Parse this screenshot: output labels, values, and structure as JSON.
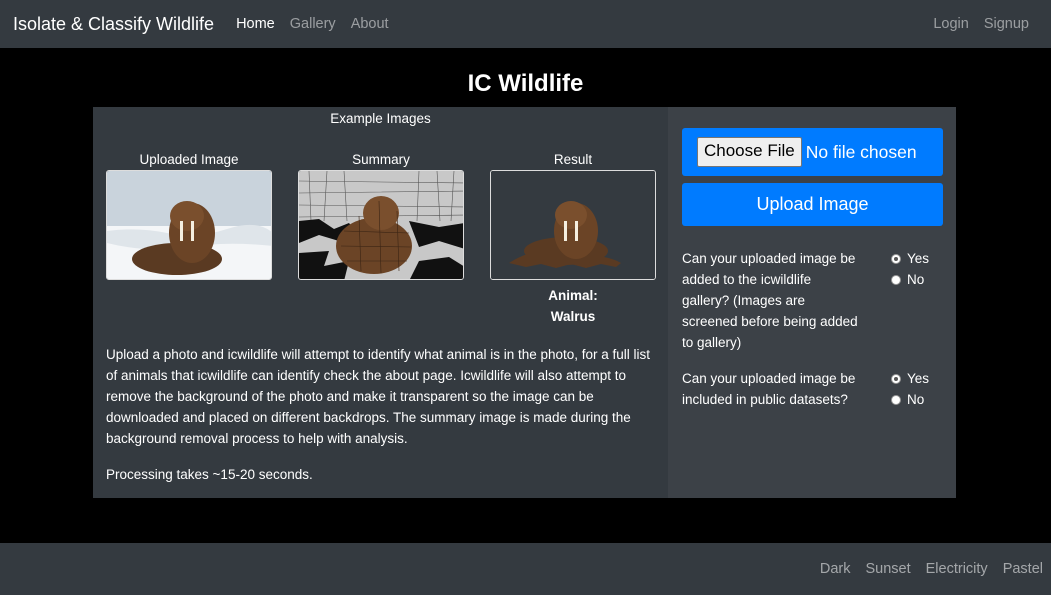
{
  "nav": {
    "brand": "Isolate & Classify Wildlife",
    "links": [
      "Home",
      "Gallery",
      "About"
    ],
    "right_links": [
      "Login",
      "Signup"
    ]
  },
  "page_title": "IC Wildlife",
  "examples": {
    "heading": "Example Images",
    "uploaded_label": "Uploaded Image",
    "summary_label": "Summary",
    "result_label": "Result",
    "animal_line1": "Animal:",
    "animal_line2": "Walrus"
  },
  "description": "Upload a photo and icwildlife will attempt to identify what animal is in the photo, for a full list of animals that icwildlife can identify check the about page. Icwildlife will also attempt to remove the background of the photo and make it transparent so the image can be downloaded and placed on different backdrops. The summary image is made during the background removal process to help with analysis.",
  "processing": "Processing takes ~15-20 seconds.",
  "upload": {
    "choose_file": "Choose File",
    "no_file": "No file chosen",
    "upload_button": "Upload Image"
  },
  "questions": [
    {
      "text": "Can your uploaded image be added to the icwildlife gallery? (Images are screened before being added to gallery)",
      "options": [
        "Yes",
        "No"
      ],
      "selected": "Yes"
    },
    {
      "text": "Can your uploaded image be included in public datasets?",
      "options": [
        "Yes",
        "No"
      ],
      "selected": "Yes"
    }
  ],
  "footer": {
    "themes": [
      "Dark",
      "Sunset",
      "Electricity",
      "Pastel"
    ]
  },
  "colors": {
    "navbar": "#343a40",
    "primary": "#007bff",
    "background": "#000000"
  }
}
